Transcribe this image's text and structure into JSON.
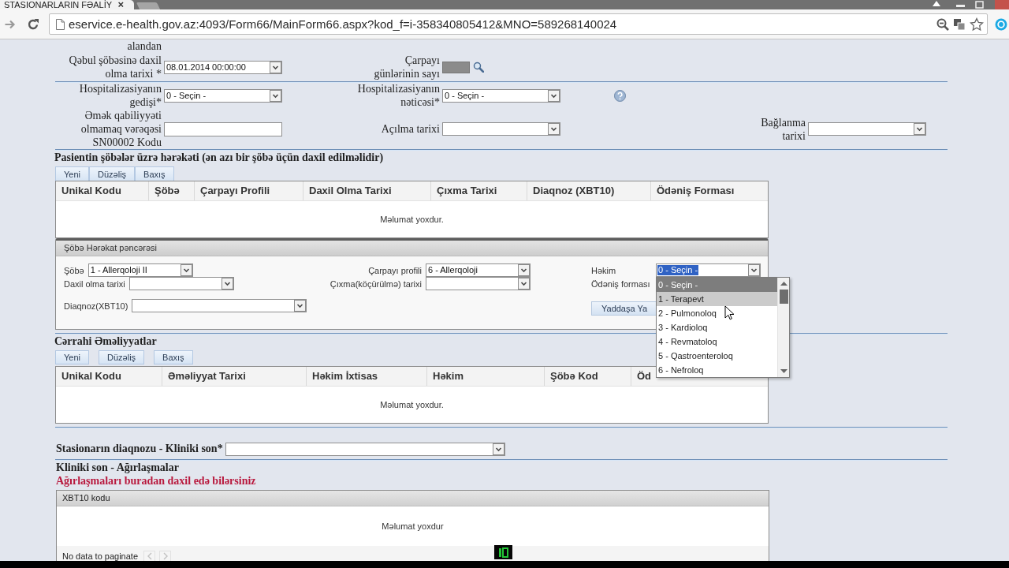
{
  "browser": {
    "tab": {
      "title": "STASIONARLARIN FƏALİY",
      "close": "×"
    },
    "url": "eservice.e-health.gov.az:4093/Form66/MainForm66.aspx?kod_f=i-358340805412&MNO=589268140024"
  },
  "top_form": {
    "cut_label": "alandan",
    "rows": [
      {
        "fields": [
          {
            "kind": "select",
            "label": "Qəbul şöbəsinə daxil\nolma tarixi *",
            "value": "08.01.2014 00:00:00"
          },
          {
            "kind": "lookup",
            "label": "Çarpayı\ngünlərinin sayı",
            "disabled": true
          }
        ]
      },
      {
        "fields": [
          {
            "kind": "select",
            "label": "Hospitalizasiyanın\ngedişi*",
            "value": "0 - Seçin -"
          },
          {
            "kind": "select",
            "label": "Hospitalizasiyanın\nnəticəsi*",
            "value": "0 - Seçin -",
            "help": true
          }
        ]
      },
      {
        "fields": [
          {
            "kind": "input",
            "label": "Əmək qabiliyyəti\nolmamaq vərəqəsi\nSN00002 Kodu"
          },
          {
            "kind": "select",
            "label": "Açılma tarixi"
          },
          {
            "kind": "select",
            "label": "Bağlanma\ntarixi"
          }
        ]
      }
    ]
  },
  "department_moves": {
    "title": "Pasientin şöbələr üzrə hərəkəti (ən azı bir şöbə üçün daxil edilməlidir)",
    "actions": [
      "Yeni",
      "Düzəliş",
      "Baxış"
    ],
    "table": {
      "columns": [
        "Unikal Kodu",
        "Şöbə",
        "Çarpayı Profili",
        "Daxil Olma Tarixi",
        "Çıxma Tarixi",
        "Diaqnoz (XBT10)",
        "Ödəniş Forması"
      ],
      "empty_text": "Məlumat yoxdur."
    }
  },
  "move_panel": {
    "title": "Şöbə Hərəkat pəncərəsi",
    "columns": [
      {
        "fields": [
          {
            "kind": "select",
            "label": "Şöbə",
            "value": "1 - Allerqoloji II"
          },
          {
            "kind": "select",
            "label": "Daxil olma tarixi"
          },
          {
            "kind": "select",
            "label": "Diaqnoz(XBT10)"
          }
        ]
      },
      {
        "fields": [
          {
            "kind": "select",
            "label": "Çarpayı profili",
            "value": "6 - Allerqoloji"
          },
          {
            "kind": "select",
            "label": "Çıxma(köçürülmə) tarixi"
          }
        ]
      },
      {
        "fields": [
          {
            "kind": "select",
            "label": "Həkim",
            "value": "0 - Seçin -",
            "highlighted": true,
            "open": true,
            "options": [
              {
                "label": "0 - Seçin -",
                "selected": true,
                "hovered": false
              },
              {
                "label": "1 - Terapevt",
                "selected": false,
                "hovered": true
              },
              {
                "label": "2 - Pulmonoloq",
                "selected": false,
                "hovered": false
              },
              {
                "label": "3 - Kardioloq",
                "selected": false,
                "hovered": false
              },
              {
                "label": "4 - Revmatoloq",
                "selected": false,
                "hovered": false
              },
              {
                "label": "5 - Qastroenteroloq",
                "selected": false,
                "hovered": false
              },
              {
                "label": "6 - Nefroloq",
                "selected": false,
                "hovered": false
              }
            ]
          },
          {
            "kind": "label",
            "label": "Ödəniş forması"
          }
        ]
      }
    ],
    "save_button": "Yaddaşa Ya"
  },
  "surgeries": {
    "title": "Cərrahi Əməliyyatlar",
    "actions": [
      "Yeni",
      "Düzəliş",
      "Baxış"
    ],
    "table": {
      "columns": [
        "Unikal Kodu",
        "Əməliyyat Tarixi",
        "Həkim İxtisas",
        "Həkim",
        "Şöbə Kod",
        "Öd"
      ],
      "empty_text": "Məlumat yoxdur."
    }
  },
  "final_diagnosis": {
    "label": "Stasionarın diaqnozu - Kliniki son*"
  },
  "complications": {
    "title": "Kliniki son - Ağırlaşmalar",
    "note": "Ağırlaşmaları buradan daxil edə bilərsiniz",
    "grid": {
      "columns": [
        "XBT10 kodu"
      ],
      "empty_text": "Məlumat yoxdur",
      "pager": {
        "text": "No data to paginate",
        "prev_disabled": true,
        "next_disabled": true
      }
    }
  }
}
